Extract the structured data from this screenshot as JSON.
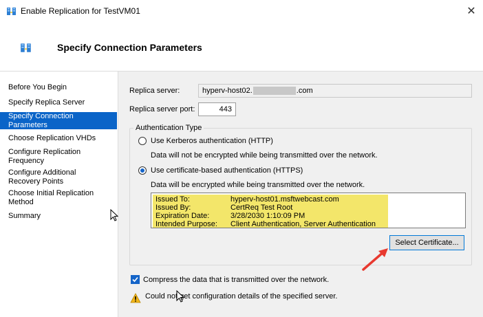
{
  "window": {
    "title": "Enable Replication for TestVM01",
    "close_label": "✕"
  },
  "header": {
    "title": "Specify Connection Parameters"
  },
  "sidebar": {
    "items": [
      {
        "label": "Before You Begin"
      },
      {
        "label": "Specify Replica Server"
      },
      {
        "label": "Specify Connection\nParameters",
        "active": true
      },
      {
        "label": "Choose Replication VHDs"
      },
      {
        "label": "Configure Replication\nFrequency"
      },
      {
        "label": "Configure Additional\nRecovery Points"
      },
      {
        "label": "Choose Initial Replication\nMethod"
      },
      {
        "label": "Summary"
      }
    ]
  },
  "form": {
    "replica_server_label": "Replica server:",
    "replica_server_prefix": "hyperv-host02.",
    "replica_server_suffix": ".com",
    "replica_port_label": "Replica server port:",
    "replica_port_value": "443",
    "auth_group_title": "Authentication Type",
    "kerberos_label": "Use Kerberos authentication (HTTP)",
    "kerberos_desc": "Data will not be encrypted while being transmitted over the network.",
    "cert_label": "Use certificate-based authentication (HTTPS)",
    "cert_desc": "Data will be encrypted while being transmitted over the network.",
    "select_cert_button": "Select Certificate...",
    "compress_label": "Compress the data that is transmitted over the network.",
    "warning_text": "Could not get configuration details of the specified server."
  },
  "certificate": {
    "rows": [
      {
        "key": "Issued To:",
        "value": "hyperv-host01.msftwebcast.com"
      },
      {
        "key": "Issued By:",
        "value": "CertReq Test Root"
      },
      {
        "key": "Expiration Date:",
        "value": "3/28/2030 1:10:09 PM"
      },
      {
        "key": "Intended Purpose:",
        "value": "Client Authentication, Server Authentication"
      }
    ]
  },
  "state": {
    "auth_selected": "certificate",
    "compress_checked": true
  },
  "colors": {
    "accent": "#0a64c8",
    "highlight": "#f3e66a",
    "arrow": "#e8392f",
    "warning": "#f2b61a"
  },
  "icons": {
    "title": "replication-icon",
    "header": "replication-icon",
    "warning": "warning-icon",
    "close": "close-icon"
  }
}
